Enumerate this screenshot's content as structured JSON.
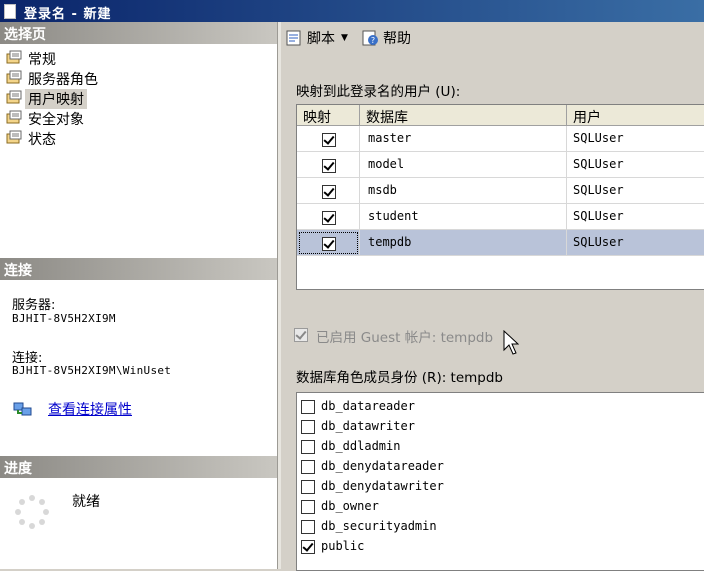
{
  "window": {
    "title": "登录名 - 新建"
  },
  "left": {
    "pages_header": "选择页",
    "pages": [
      {
        "label": "常规",
        "selected": false
      },
      {
        "label": "服务器角色",
        "selected": false
      },
      {
        "label": "用户映射",
        "selected": true
      },
      {
        "label": "安全对象",
        "selected": false
      },
      {
        "label": "状态",
        "selected": false
      }
    ],
    "connection_header": "连接",
    "server_label": "服务器:",
    "server_value": "BJHIT-8V5H2XI9M",
    "connection_label": "连接:",
    "connection_value": "BJHIT-8V5H2XI9M\\WinUset",
    "view_connection_link": "查看连接属性",
    "progress_header": "进度",
    "progress_status": "就绪"
  },
  "toolbar": {
    "script_label": "脚本",
    "help_label": "帮助"
  },
  "users_mapped": {
    "label": "映射到此登录名的用户 (U):",
    "columns": [
      "映射",
      "数据库",
      "用户"
    ],
    "rows": [
      {
        "mapped": true,
        "database": "master",
        "user": "SQLUser",
        "selected": false
      },
      {
        "mapped": true,
        "database": "model",
        "user": "SQLUser",
        "selected": false
      },
      {
        "mapped": true,
        "database": "msdb",
        "user": "SQLUser",
        "selected": false
      },
      {
        "mapped": true,
        "database": "student",
        "user": "SQLUser",
        "selected": false
      },
      {
        "mapped": true,
        "database": "tempdb",
        "user": "SQLUser",
        "selected": true
      }
    ]
  },
  "guest": {
    "label": "已启用 Guest 帐户: tempdb",
    "checked": true,
    "enabled": false
  },
  "roles": {
    "label": "数据库角色成员身份 (R): tempdb",
    "items": [
      {
        "name": "db_datareader",
        "checked": false
      },
      {
        "name": "db_datawriter",
        "checked": false
      },
      {
        "name": "db_ddladmin",
        "checked": false
      },
      {
        "name": "db_denydatareader",
        "checked": false
      },
      {
        "name": "db_denydatawriter",
        "checked": false
      },
      {
        "name": "db_owner",
        "checked": false
      },
      {
        "name": "db_securityadmin",
        "checked": false
      },
      {
        "name": "public",
        "checked": true
      }
    ]
  }
}
